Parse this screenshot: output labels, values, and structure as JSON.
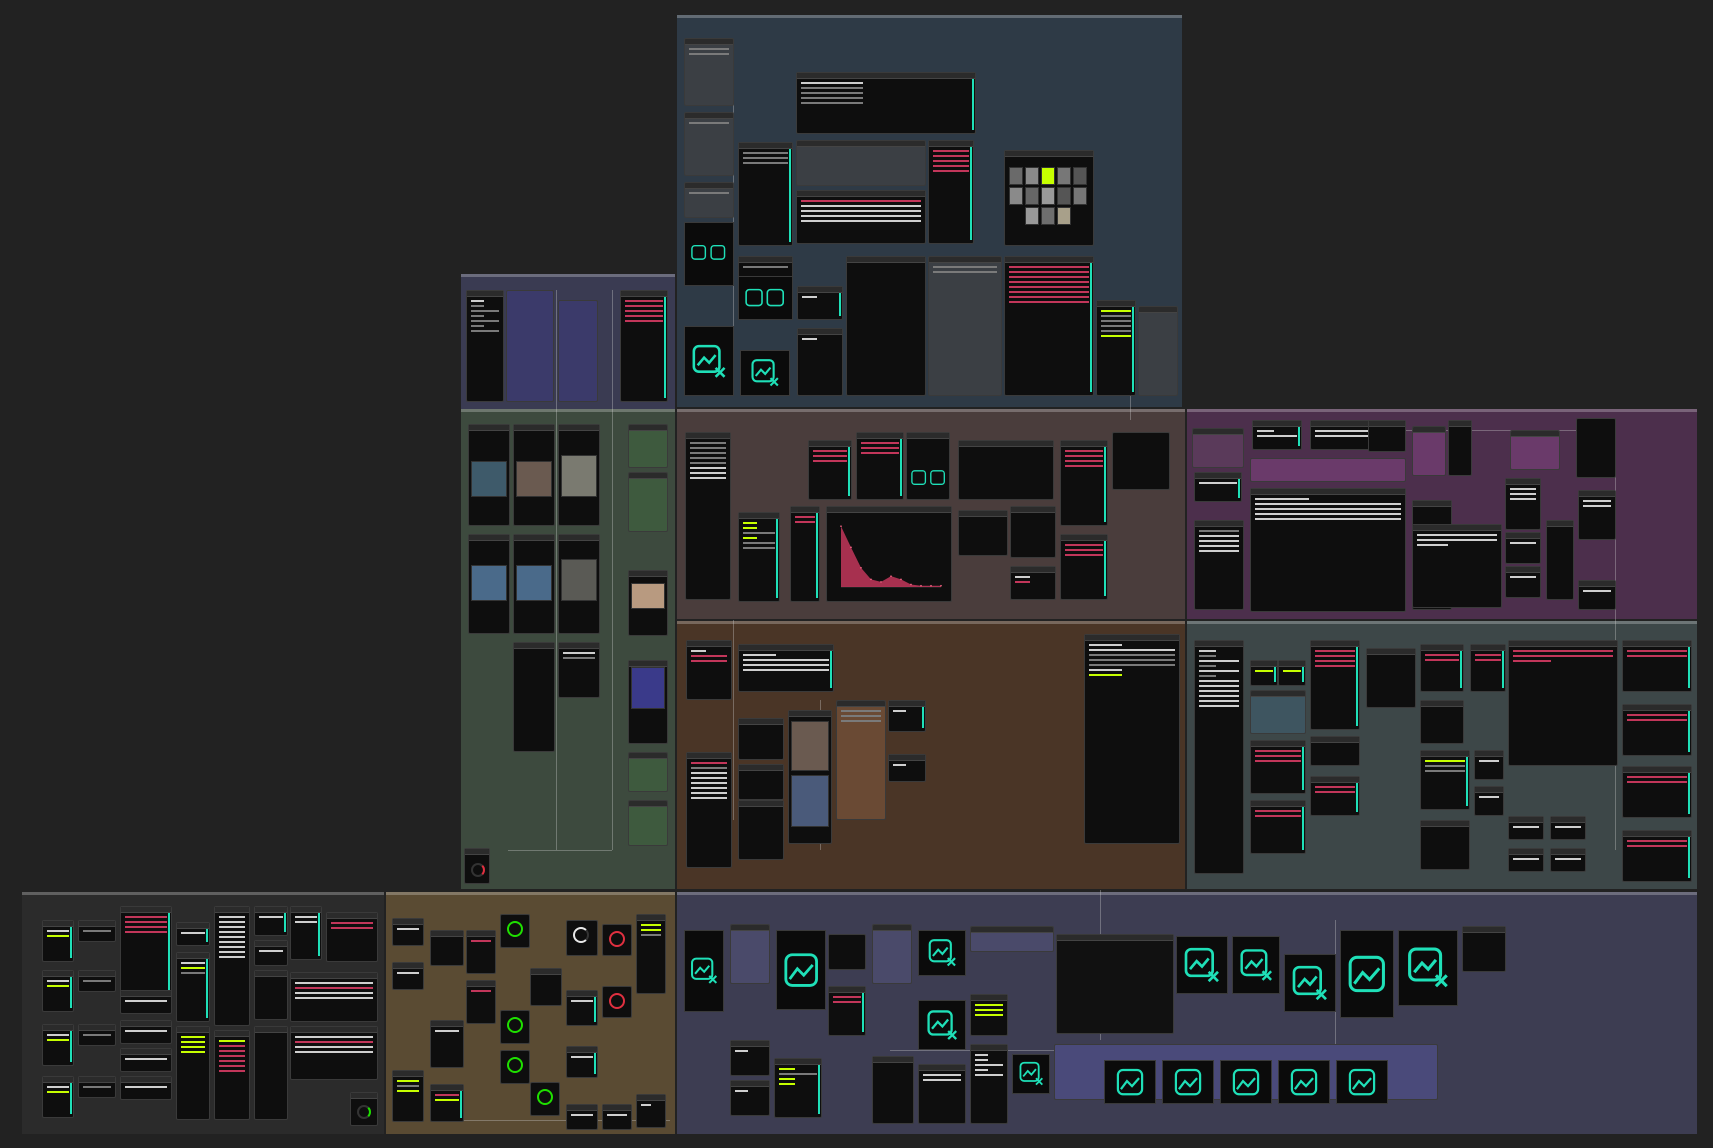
{
  "app": {
    "name": "node-graph-canvas",
    "background": "#222222",
    "accent_color": "#1fe0b8",
    "error_color": "#c2365a",
    "highlight_color": "#c6ff00"
  },
  "icons": {
    "missing_image": "image-with-x-icon",
    "image_preview": "image-icon",
    "progress_ring": "ring-gauge-icon"
  },
  "groups": [
    {
      "id": "group-blue-top",
      "color": "#2e3a46"
    },
    {
      "id": "group-indigo-left",
      "color": "#3a3b52"
    },
    {
      "id": "group-green-left",
      "color": "#3d4a3e"
    },
    {
      "id": "group-brown-center",
      "color": "#4a3d3c"
    },
    {
      "id": "group-magenta-right",
      "color": "#4c2f4c"
    },
    {
      "id": "group-orange-brown",
      "color": "#4a3526"
    },
    {
      "id": "group-slate-right",
      "color": "#3d4748"
    },
    {
      "id": "group-dark-bottom-left",
      "color": "#2b2b2b"
    },
    {
      "id": "group-olive-bottom",
      "color": "#5a4b33"
    },
    {
      "id": "group-violet-bottom",
      "color": "#3d3d52"
    }
  ],
  "chart_data": {
    "type": "area",
    "title": "",
    "xlabel": "",
    "ylabel": "",
    "series": [
      {
        "values": [
          0.95,
          0.62,
          0.3,
          0.12,
          0.08,
          0.17,
          0.12,
          0.04,
          0.02,
          0.02,
          0.02
        ]
      }
    ]
  }
}
